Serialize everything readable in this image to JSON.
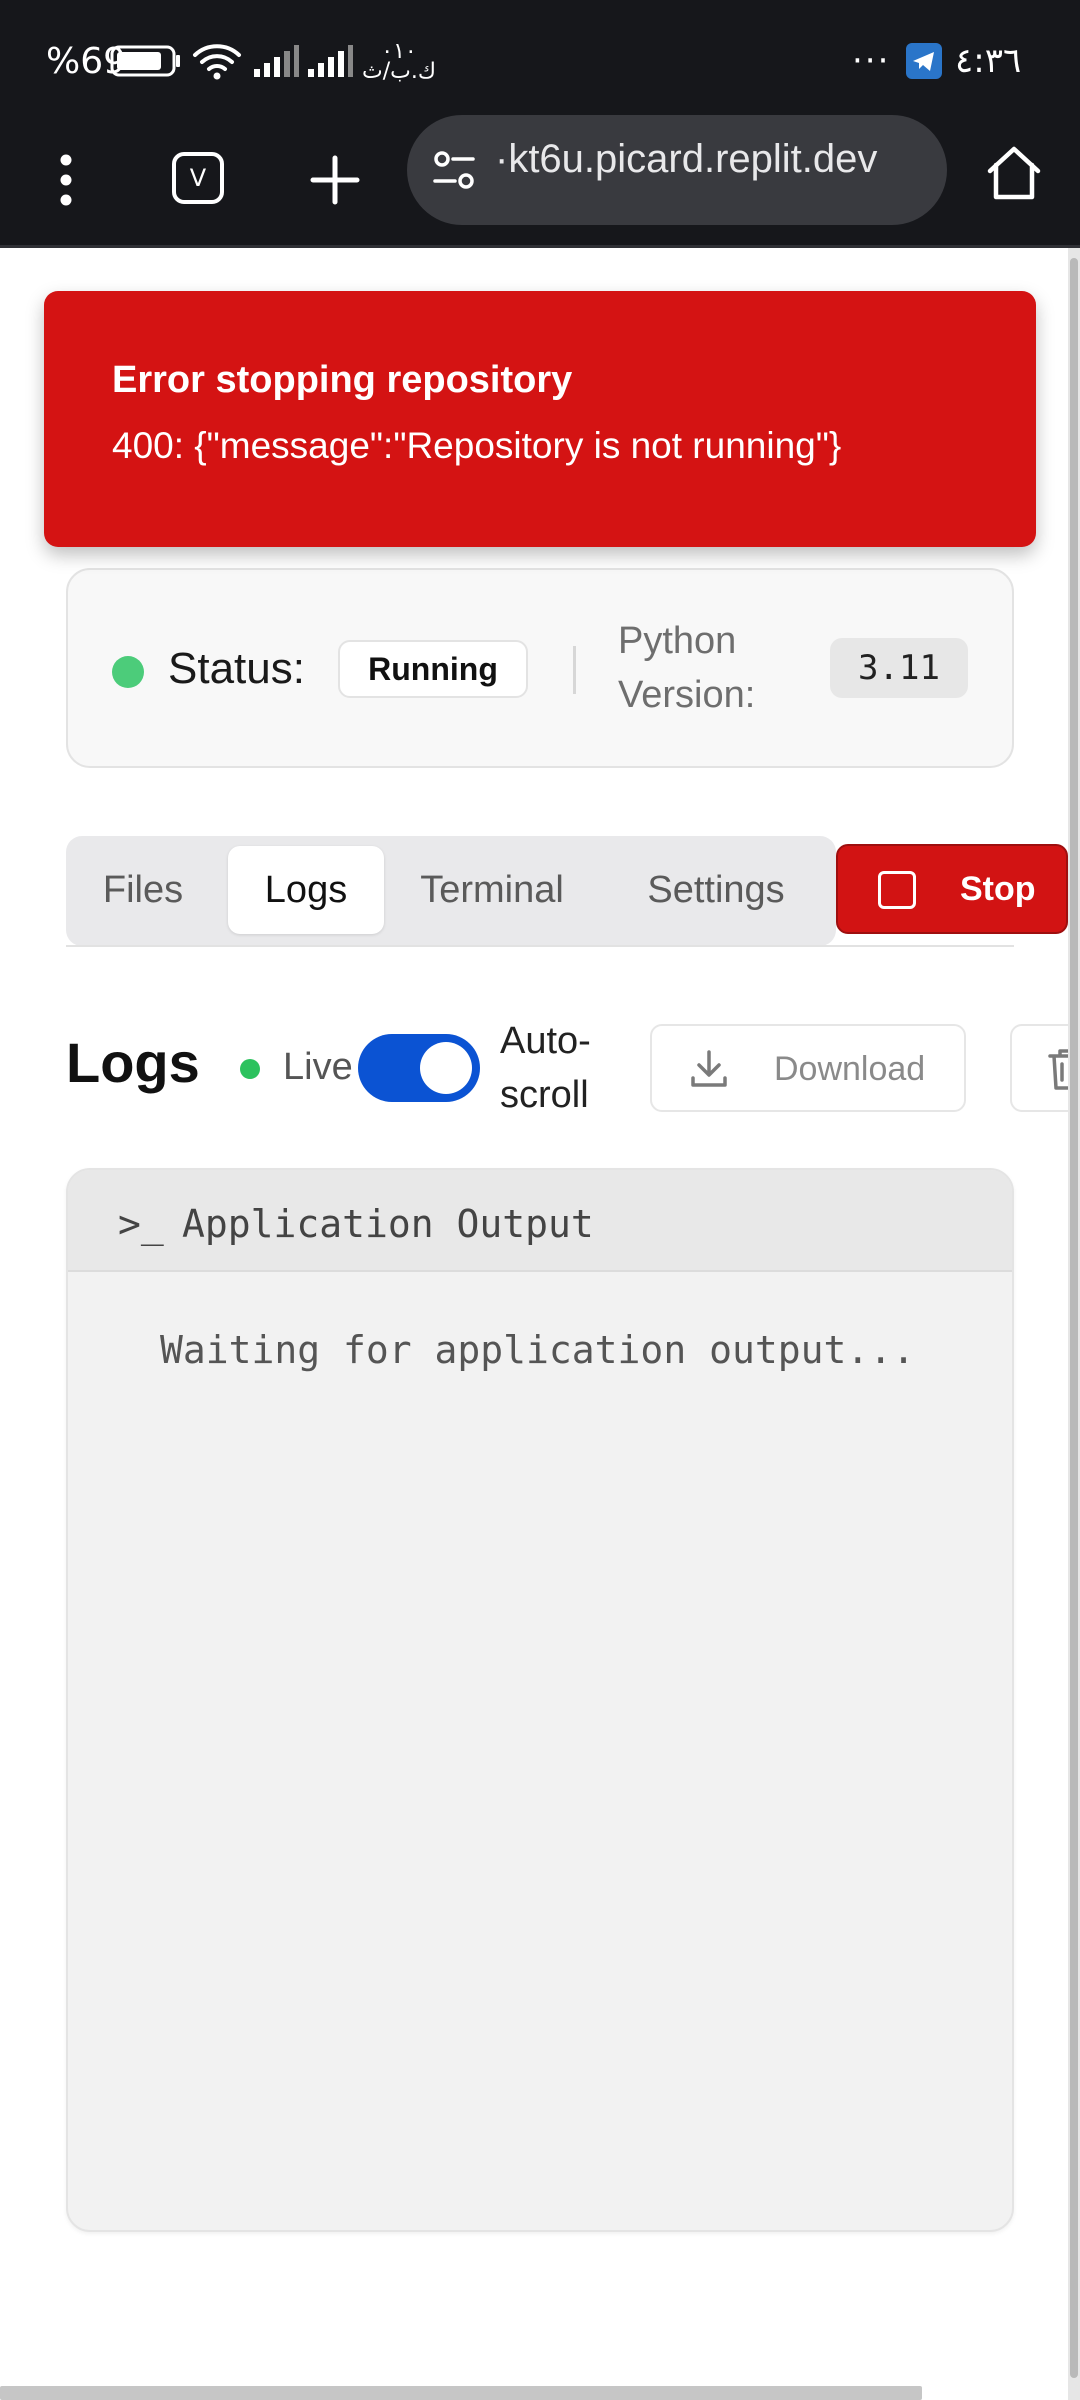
{
  "status_bar": {
    "battery_percent": "%69",
    "network_speed_line1": "٠١٠",
    "network_speed_line2": "ك.ب/ث",
    "overflow": "···",
    "clock": "٤:٣٦"
  },
  "browser": {
    "tabs_count": "V",
    "url": "·kt6u.picard.replit.dev"
  },
  "toast": {
    "title": "Error stopping repository",
    "message": "400: {\"message\":\"Repository is not running\"}"
  },
  "status_card": {
    "status_label": "Status:",
    "status_value": "Running",
    "python_label": "Python Version:",
    "python_value": "3.11"
  },
  "tabs": [
    {
      "label": "Files"
    },
    {
      "label": "Logs",
      "active": true
    },
    {
      "label": "Terminal"
    },
    {
      "label": "Settings"
    }
  ],
  "stop_button": {
    "label": "Stop"
  },
  "logs": {
    "title": "Logs",
    "live_label": "Live",
    "autoscroll_label": "Auto-scroll",
    "autoscroll_on": true,
    "download_label": "Download"
  },
  "output": {
    "prompt": ">_",
    "title": "Application Output",
    "waiting_text": "Waiting for application output..."
  },
  "colors": {
    "error_red": "#d41313",
    "toggle_blue": "#0b53d3",
    "live_green": "#2cc25e",
    "status_green": "#4ccc7a",
    "browser_dark": "#16171b"
  },
  "icons": {
    "menu": "more-vert-icon",
    "tabs": "tab-switcher-icon",
    "new_tab": "plus-icon",
    "site_info": "tune-icon",
    "home": "home-icon",
    "download": "download-icon",
    "clear": "trash-icon",
    "stop": "square-stop-icon"
  }
}
